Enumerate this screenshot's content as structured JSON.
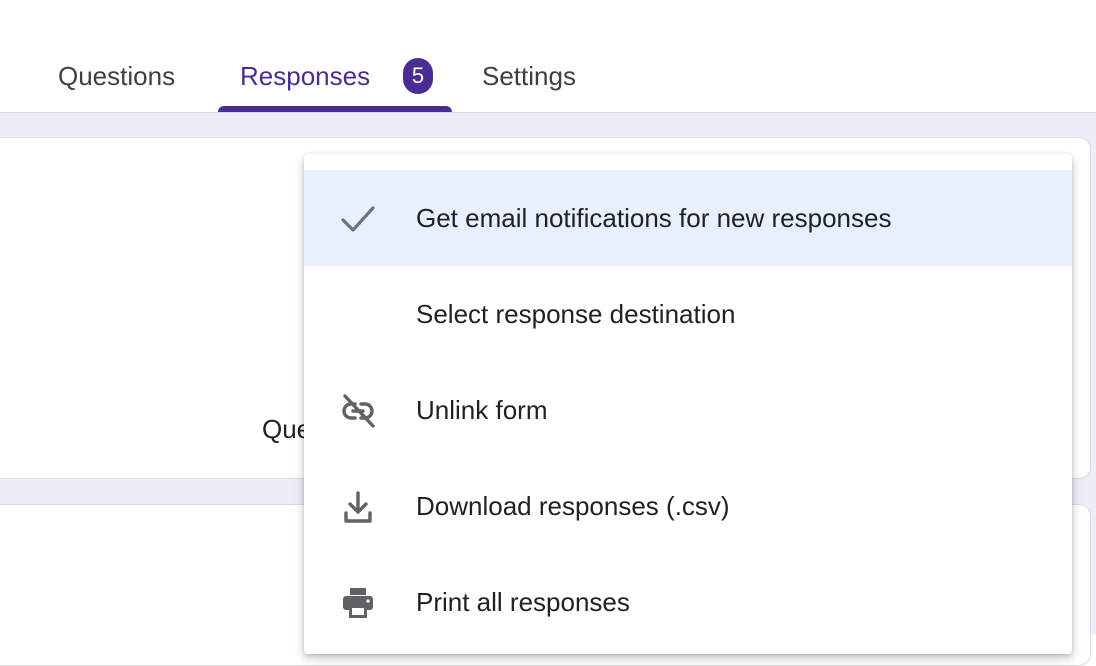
{
  "tabs": [
    {
      "label": "Questions"
    },
    {
      "label": "Responses",
      "badge": "5"
    },
    {
      "label": "Settings"
    }
  ],
  "accent_color": "#4b2c94",
  "card": {
    "title_partial": "Que"
  },
  "menu": {
    "items": [
      {
        "label": "Get email notifications for new responses",
        "icon": "checkmark-icon",
        "checked": true
      },
      {
        "label": "Select response destination",
        "icon": ""
      },
      {
        "label": "Unlink form",
        "icon": "link-off-icon"
      },
      {
        "label": "Download responses (.csv)",
        "icon": "download-icon"
      },
      {
        "label": "Print all responses",
        "icon": "print-icon"
      }
    ]
  }
}
